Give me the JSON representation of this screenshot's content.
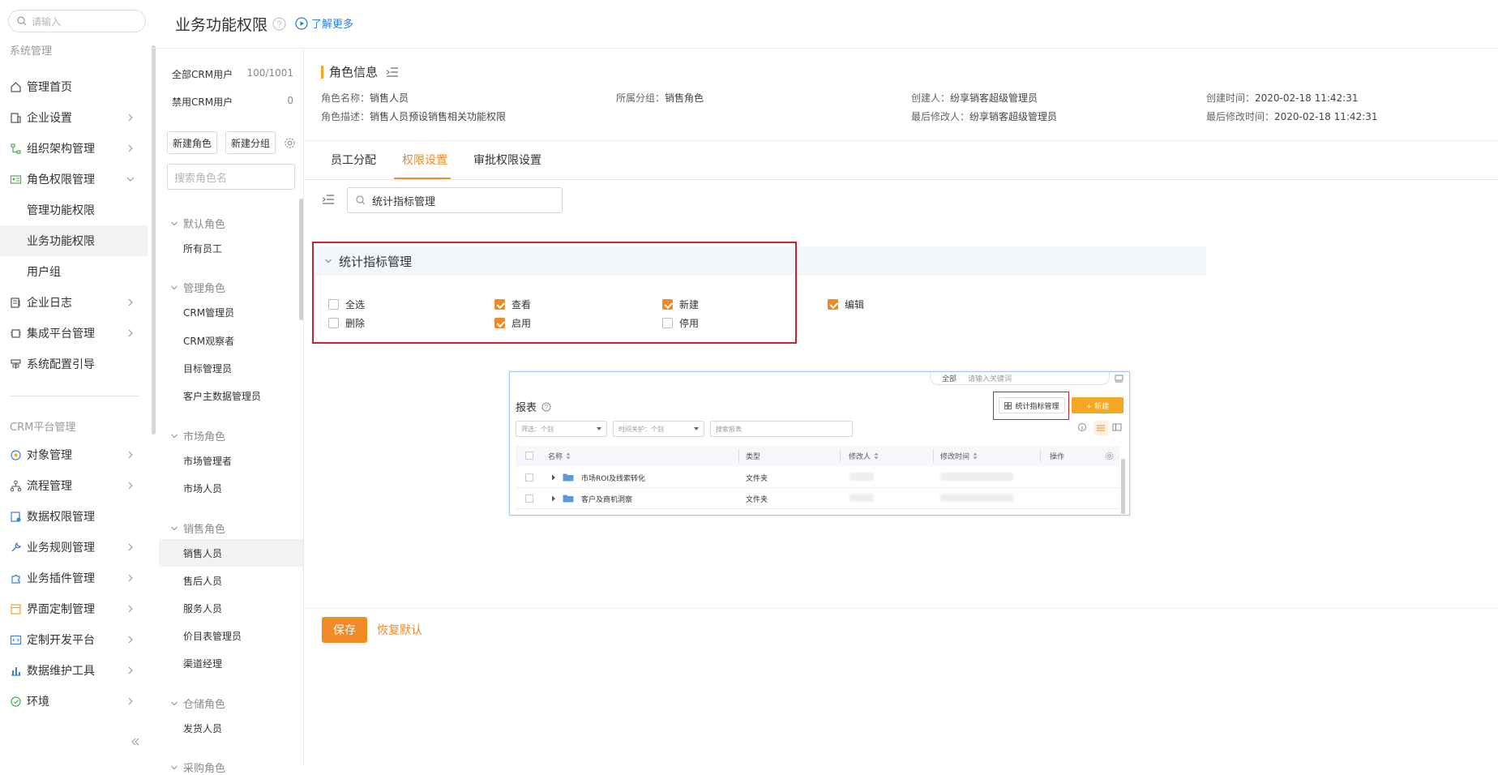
{
  "nav": {
    "search_placeholder": "请输入",
    "section_system": "系统管理",
    "items": [
      {
        "label": "管理首页"
      },
      {
        "label": "企业设置"
      },
      {
        "label": "组织架构管理"
      },
      {
        "label": "角色权限管理"
      },
      {
        "label": "管理功能权限"
      },
      {
        "label": "业务功能权限"
      },
      {
        "label": "用户组"
      },
      {
        "label": "企业日志"
      },
      {
        "label": "集成平台管理"
      },
      {
        "label": "系统配置引导"
      }
    ],
    "section_crm": "CRM平台管理",
    "crm_items": [
      {
        "label": "对象管理"
      },
      {
        "label": "流程管理"
      },
      {
        "label": "数据权限管理"
      },
      {
        "label": "业务规则管理"
      },
      {
        "label": "业务插件管理"
      },
      {
        "label": "界面定制管理"
      },
      {
        "label": "定制开发平台"
      },
      {
        "label": "数据维护工具"
      },
      {
        "label": "环境"
      }
    ]
  },
  "header": {
    "title": "业务功能权限",
    "learn_more": "了解更多"
  },
  "role_panel": {
    "all_users_label": "全部CRM用户",
    "all_users_count": "100/1001",
    "disabled_users_label": "禁用CRM用户",
    "disabled_users_count": "0",
    "new_role_btn": "新建角色",
    "new_group_btn": "新建分组",
    "search_placeholder": "搜索角色名",
    "groups": {
      "default": "默认角色",
      "manage": "管理角色",
      "market": "市场角色",
      "sales": "销售角色",
      "warehouse": "仓储角色",
      "purchase": "采购角色"
    },
    "roles": {
      "all_staff": "所有员工",
      "crm_admin": "CRM管理员",
      "crm_observer": "CRM观察者",
      "target_admin": "目标管理员",
      "customer_master_admin": "客户主数据管理员",
      "market_manager": "市场管理者",
      "market_staff": "市场人员",
      "sales_staff": "销售人员",
      "after_sales": "售后人员",
      "service_staff": "服务人员",
      "price_admin": "价目表管理员",
      "channel_manager": "渠道经理",
      "shipping_staff": "发货人员"
    }
  },
  "role_info": {
    "title": "角色信息",
    "name_label": "角色名称：",
    "name_value": "销售人员",
    "group_label": "所属分组：",
    "group_value": "销售角色",
    "creator_label": "创建人：",
    "creator_value": "纷享销客超级管理员",
    "created_label": "创建时间：",
    "created_value": "2020-02-18 11:42:31",
    "desc_label": "角色描述：",
    "desc_value": "销售人员预设销售相关功能权限",
    "modifier_label": "最后修改人：",
    "modifier_value": "纷享销客超级管理员",
    "modified_label": "最后修改时间：",
    "modified_value": "2020-02-18 11:42:31"
  },
  "tabs": {
    "staff": "员工分配",
    "perm": "权限设置",
    "approval": "审批权限设置"
  },
  "perm": {
    "search_value": "统计指标管理",
    "section_title": "统计指标管理",
    "checkboxes": {
      "select_all": {
        "label": "全选",
        "checked": false
      },
      "view": {
        "label": "查看",
        "checked": true
      },
      "create": {
        "label": "新建",
        "checked": true
      },
      "edit": {
        "label": "编辑",
        "checked": true
      },
      "delete": {
        "label": "删除",
        "checked": false
      },
      "enable": {
        "label": "启用",
        "checked": true
      },
      "disable": {
        "label": "停用",
        "checked": false
      }
    }
  },
  "embedded": {
    "scope_select": "全部",
    "keyword_placeholder": "请输入关键词",
    "title": "报表",
    "stat_btn": "统计指标管理",
    "new_btn": "+ 新建",
    "filter1": "筛选：个别",
    "filter2": "时间关护：个别",
    "search_placeholder": "搜索报表",
    "columns": {
      "name": "名称",
      "type": "类型",
      "modifier": "修改人",
      "modified_time": "修改时间",
      "ops": "操作"
    },
    "rows": [
      {
        "name": "市场ROI及线索转化",
        "type": "文件夹"
      },
      {
        "name": "客户及商机洞察",
        "type": "文件夹"
      }
    ]
  },
  "footer": {
    "save": "保存",
    "reset": "恢复默认"
  },
  "colors": {
    "accent": "#f08a24",
    "highlight": "#c8242f",
    "link": "#2f7fd6"
  }
}
